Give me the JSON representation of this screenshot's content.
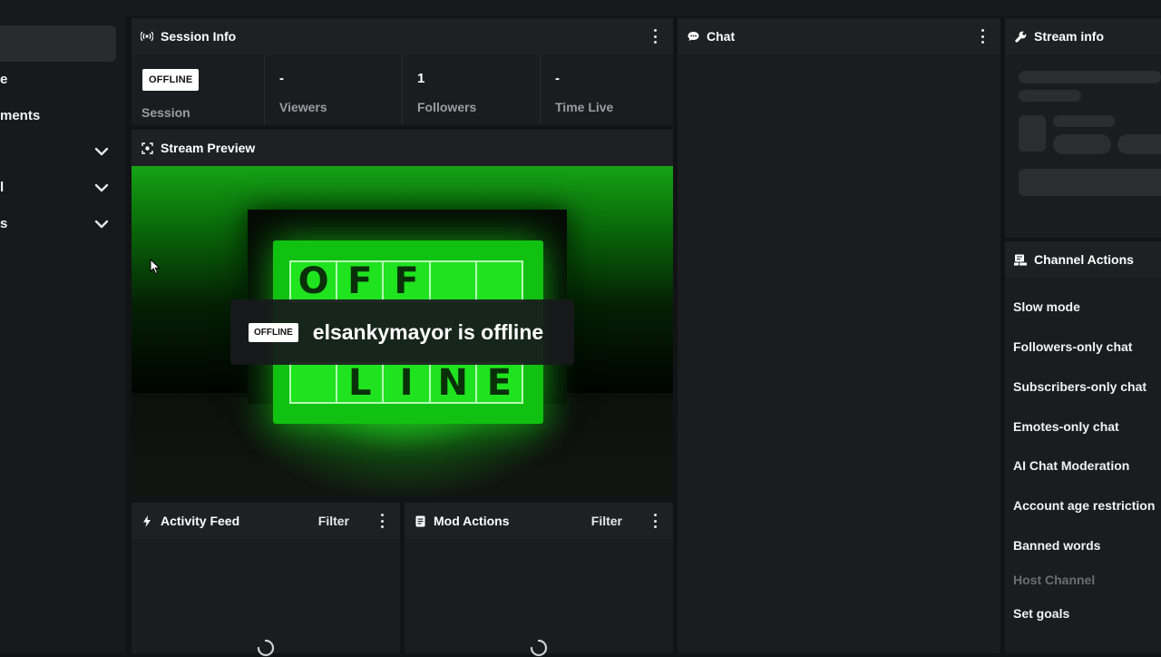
{
  "sidebar": {
    "items": [
      {
        "label": "e"
      },
      {
        "label": "ments"
      },
      {
        "label": "l"
      },
      {
        "label": "s"
      }
    ]
  },
  "session": {
    "title": "Session Info",
    "status_badge": "OFFLINE",
    "session_label": "Session",
    "stats": [
      {
        "value": "-",
        "label": "Viewers"
      },
      {
        "value": "1",
        "label": "Followers"
      },
      {
        "value": "-",
        "label": "Time Live"
      }
    ]
  },
  "preview": {
    "title": "Stream Preview",
    "badge": "OFFLINE",
    "message": "elsankymayor is offline",
    "banner_text_top": "OFF",
    "banner_text_bottom": "LINE"
  },
  "activity": {
    "title": "Activity Feed",
    "filter_label": "Filter"
  },
  "mod_actions": {
    "title": "Mod Actions",
    "filter_label": "Filter"
  },
  "chat": {
    "title": "Chat"
  },
  "stream_info": {
    "title": "Stream info"
  },
  "channel_actions": {
    "title": "Channel Actions",
    "items": [
      {
        "label": "Slow mode"
      },
      {
        "label": "Followers-only chat"
      },
      {
        "label": "Subscribers-only chat"
      },
      {
        "label": "Emotes-only chat"
      },
      {
        "label": "AI Chat Moderation"
      },
      {
        "label": "Account age restriction"
      },
      {
        "label": "Banned words"
      },
      {
        "label": "Host Channel"
      },
      {
        "label": "Set goals"
      }
    ]
  },
  "colors": {
    "accent_green": "#19ff19",
    "bg": "#121315",
    "panel": "#1b1c1f"
  }
}
